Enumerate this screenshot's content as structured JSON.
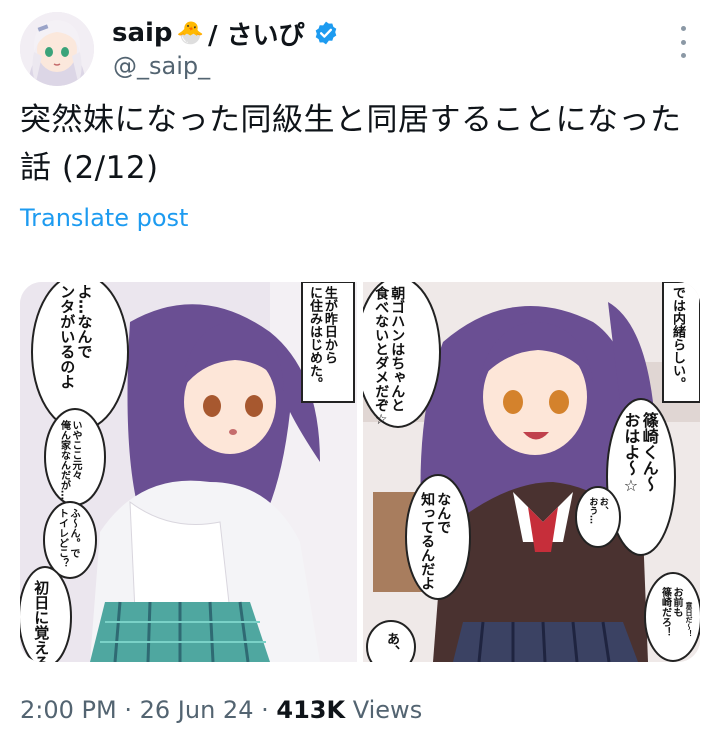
{
  "author": {
    "display_name": "saip",
    "display_emoji": "🐣",
    "name_suffix": "/ さいぴ",
    "handle": "@_saip_",
    "verified": true,
    "verified_color": "#1d9bf0"
  },
  "post": {
    "text": "突然妹になった同級生と同居することになった話 (2/12)",
    "translate_label": "Translate post"
  },
  "media": {
    "left_panel": {
      "caption": "生が昨日から\nに住みはじめた。",
      "bubble_top": "よ…なんで\nンタがいるのよ",
      "bubble_mid": "いやここ元々\n俺ん家なんだが…",
      "bubble_small": "ふ〜ん。で\nトイレどこ？",
      "bubble_bottom": "初日に覚えろ"
    },
    "right_panel": {
      "bubble_top_left": "朝ゴハンはちゃんと\n食べないとダメだぞ☆",
      "caption": "では内緒らしい。",
      "bubble_center": "篠崎くん〜\nおはよ〜☆",
      "bubble_small": "お、\nおう…",
      "bubble_mid": "なんで\n知ってるんだよ",
      "bubble_right": "お前も\n篠崎だろ！",
      "bubble_right_small": "意日だ〜！",
      "bubble_bottom": "あ、"
    }
  },
  "meta": {
    "time": "2:00 PM",
    "separator": "·",
    "date": "26 Jun 24",
    "views_count": "413K",
    "views_label": "Views"
  },
  "colors": {
    "link": "#1d9bf0",
    "secondary_text": "#536471",
    "hair": "#6a4f93"
  }
}
